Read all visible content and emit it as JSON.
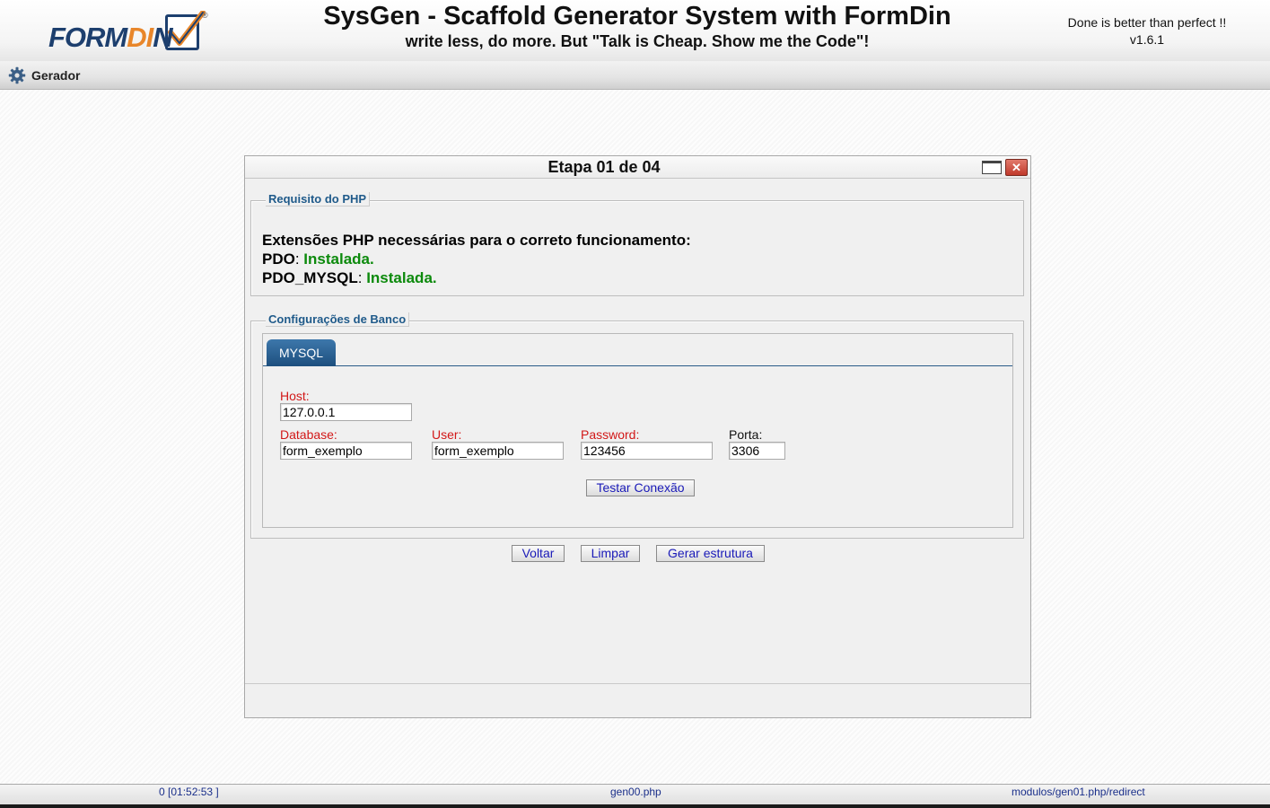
{
  "header": {
    "logo_text": "FORMDIN",
    "title": "SysGen - Scaffold Generator System with FormDin",
    "subtitle": "write less, do more. But \"Talk is Cheap. Show me the Code\"!",
    "motto": "Done is better than perfect !!",
    "version": "v1.6.1"
  },
  "menu": {
    "items": [
      {
        "label": "Gerador",
        "icon": "gear-icon"
      }
    ]
  },
  "window": {
    "title": "Etapa 01 de 04",
    "php_section": {
      "legend": "Requisito do PHP",
      "heading": "Extensões PHP necessárias para o correto funcionamento:",
      "extensions": [
        {
          "name": "PDO",
          "sep": ": ",
          "status": "Instalada."
        },
        {
          "name": "PDO_MYSQL",
          "sep": ": ",
          "status": "Instalada."
        }
      ]
    },
    "db_section": {
      "legend": "Configurações de Banco",
      "tabs": [
        {
          "label": "MYSQL"
        }
      ],
      "fields": {
        "host": {
          "label": "Host:",
          "value": "127.0.0.1"
        },
        "database": {
          "label": "Database:",
          "value": "form_exemplo"
        },
        "user": {
          "label": "User:",
          "value": "form_exemplo"
        },
        "password": {
          "label": "Password:",
          "value": "123456"
        },
        "porta": {
          "label": "Porta:",
          "value": "3306"
        }
      },
      "test_button": "Testar Conexão"
    },
    "actions": {
      "back": "Voltar",
      "clear": "Limpar",
      "generate": "Gerar estrutura"
    }
  },
  "statusbar": {
    "left": "0 [01:52:53 ]",
    "center": "gen00.php",
    "right": "modulos/gen01.php/redirect"
  },
  "colors": {
    "accent_blue": "#1f5a8a",
    "tab_blue": "#1d4f7e",
    "required_label": "#d21818",
    "installed_green": "#0c8a0c",
    "button_text": "#1a1ab8"
  }
}
